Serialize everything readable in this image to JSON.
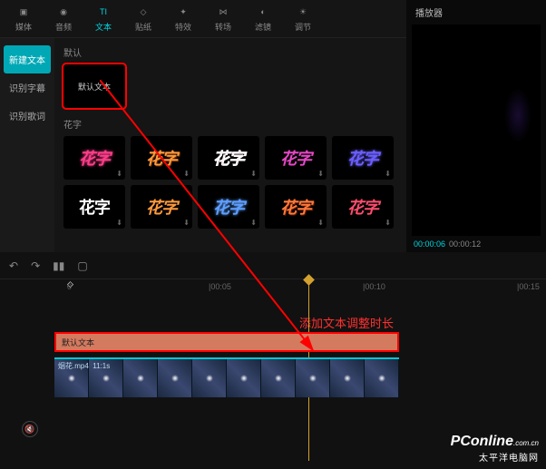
{
  "toolbar": {
    "items": [
      {
        "label": "媒体"
      },
      {
        "label": "音频"
      },
      {
        "label": "文本"
      },
      {
        "label": "贴纸"
      },
      {
        "label": "特效"
      },
      {
        "label": "转场"
      },
      {
        "label": "滤镜"
      },
      {
        "label": "调节"
      }
    ]
  },
  "sidebar": {
    "items": [
      {
        "label": "新建文本"
      },
      {
        "label": "识别字幕"
      },
      {
        "label": "识别歌词"
      }
    ]
  },
  "templates": {
    "section1_label": "默认",
    "default_text": "默认文本",
    "section2_label": "花字",
    "huazi_text": "花字"
  },
  "player": {
    "title": "播放器",
    "current_time": "00:00:06",
    "total_time": "00:00:12"
  },
  "timeline": {
    "ruler": [
      "0",
      "|00:05",
      "|00:10",
      "|00:15"
    ],
    "annotation": "添加文本调整时长",
    "text_clip_label": "默认文本",
    "video_clip_label": "烟花.mp4",
    "video_clip_duration": "11:1s"
  },
  "watermark": {
    "logo": "PConline",
    "suffix": ".com.cn",
    "subtitle": "太平洋电脑网"
  }
}
